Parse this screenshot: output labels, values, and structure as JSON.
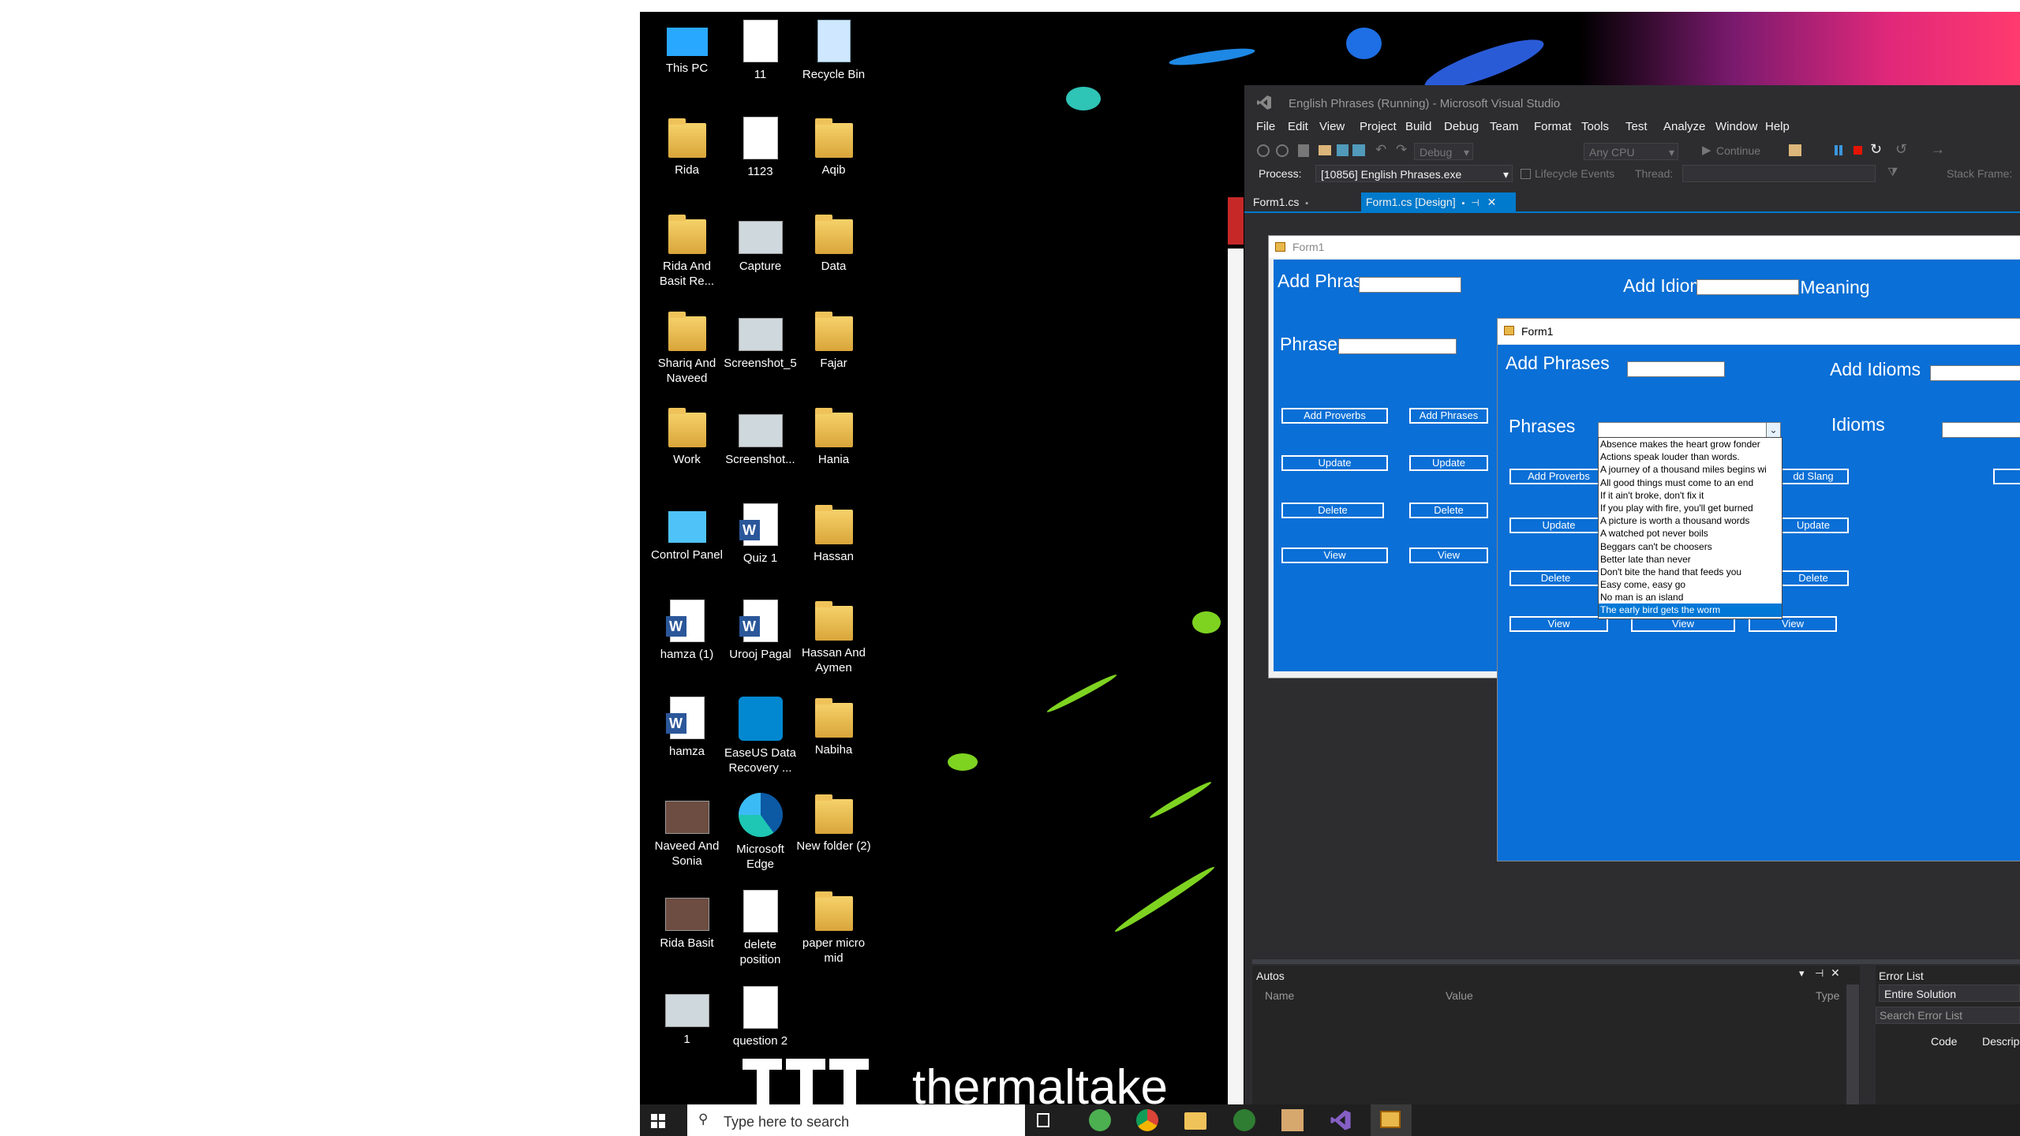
{
  "desktop": {
    "icons": [
      {
        "label": "This PC",
        "glyph": "this-pc-icon"
      },
      {
        "label": "11",
        "glyph": "document-icon"
      },
      {
        "label": "Recycle Bin",
        "glyph": "recycle-bin-icon"
      },
      {
        "label": "Rida",
        "glyph": "folder-icon"
      },
      {
        "label": "1123",
        "glyph": "document-icon"
      },
      {
        "label": "Aqib",
        "glyph": "folder-icon"
      },
      {
        "label": "Rida And Basit Re...",
        "glyph": "folder-icon"
      },
      {
        "label": "Capture",
        "glyph": "image-icon"
      },
      {
        "label": "Data",
        "glyph": "folder-icon"
      },
      {
        "label": "Shariq And Naveed",
        "glyph": "folder-icon"
      },
      {
        "label": "Screenshot_5",
        "glyph": "image-icon"
      },
      {
        "label": "Fajar",
        "glyph": "folder-icon"
      },
      {
        "label": "Work",
        "glyph": "folder-icon"
      },
      {
        "label": "Screenshot...",
        "glyph": "image-icon"
      },
      {
        "label": "Hania",
        "glyph": "folder-icon"
      },
      {
        "label": "Control Panel",
        "glyph": "control-panel-icon"
      },
      {
        "label": "Quiz 1",
        "glyph": "word-document-icon"
      },
      {
        "label": "Hassan",
        "glyph": "folder-icon"
      },
      {
        "label": "hamza (1)",
        "glyph": "word-document-icon"
      },
      {
        "label": "Urooj Pagal",
        "glyph": "word-document-icon"
      },
      {
        "label": "Hassan And Aymen",
        "glyph": "folder-icon"
      },
      {
        "label": "hamza",
        "glyph": "word-document-icon"
      },
      {
        "label": "EaseUS Data Recovery ...",
        "glyph": "easeus-icon"
      },
      {
        "label": "Nabiha",
        "glyph": "folder-icon"
      },
      {
        "label": "Naveed And Sonia",
        "glyph": "video-icon"
      },
      {
        "label": "Microsoft Edge",
        "glyph": "edge-icon"
      },
      {
        "label": "New folder (2)",
        "glyph": "folder-icon"
      },
      {
        "label": "Rida Basit",
        "glyph": "video-icon"
      },
      {
        "label": "delete position",
        "glyph": "blank-file-icon"
      },
      {
        "label": "paper micro mid",
        "glyph": "folder-icon"
      },
      {
        "label": "1",
        "glyph": "image-icon"
      },
      {
        "label": "question 2",
        "glyph": "blank-file-icon"
      }
    ],
    "wallpaper_brand": "thermaltake"
  },
  "vs": {
    "title": "English Phrases (Running) - Microsoft Visual Studio",
    "menu": [
      "File",
      "Edit",
      "View",
      "Project",
      "Build",
      "Debug",
      "Team",
      "Format",
      "Tools",
      "Test",
      "Analyze",
      "Window",
      "Help"
    ],
    "toolbar": {
      "config": "Debug",
      "platform": "Any CPU",
      "continue_label": "Continue"
    },
    "process_bar": {
      "process_label": "Process:",
      "process_value": "[10856] English Phrases.exe",
      "lifecycle_label": "Lifecycle Events",
      "thread_label": "Thread:",
      "stack_frame_label": "Stack Frame:"
    },
    "tabs": [
      {
        "label": "Form1.cs",
        "active": false
      },
      {
        "label": "Form1.cs [Design]",
        "active": true
      }
    ],
    "autos": {
      "title": "Autos",
      "columns": [
        "Name",
        "Value",
        "Type"
      ]
    },
    "error_list": {
      "title": "Error List",
      "scope": "Entire Solution",
      "search_placeholder": "Search Error List",
      "columns": [
        "Code",
        "Descrip"
      ]
    }
  },
  "designer_form": {
    "caption": "Form1",
    "add_phrases_label": "Add Phrases",
    "add_idioms_label": "Add Idioms",
    "add_meaning_label": "Add Meaning",
    "phrases_label": "Phrases",
    "buttons": [
      "Add Proverbs",
      "Add Phrases",
      "Update",
      "Update",
      "Delete",
      "Delete",
      "View",
      "View"
    ]
  },
  "running_form": {
    "caption": "Form1",
    "add_phrases_label": "Add Phrases",
    "add_idioms_label": "Add Idioms",
    "phrases_label": "Phrases",
    "idioms_label": "Idioms",
    "buttons": {
      "add_proverbs": "Add Proverbs",
      "add_slang": "dd Slang",
      "update1": "Update",
      "update2": "Update",
      "delete1": "Delete",
      "delete2": "Delete",
      "view1": "View",
      "view2": "View",
      "view3": "View"
    },
    "phrases_list": [
      "Absence makes the heart grow fonder",
      "Actions speak louder than words.",
      "A journey of a thousand miles begins wi",
      "All good things must come to an end",
      "If it ain't broke, don't fix it",
      "If you play with fire, you'll get burned",
      "A picture is worth a thousand words",
      "A watched pot never boils",
      "Beggars can't be choosers",
      "Better late than never",
      "Don't bite the hand that feeds you",
      "Easy come, easy go",
      "No man is an island",
      "The early bird gets the worm"
    ],
    "selected_index": 13
  },
  "taskbar": {
    "search_placeholder": "Type here to search"
  },
  "colors": {
    "form_blue": "#0a6fd6",
    "vs_dark": "#2d2d30",
    "vs_accent": "#007acc"
  }
}
